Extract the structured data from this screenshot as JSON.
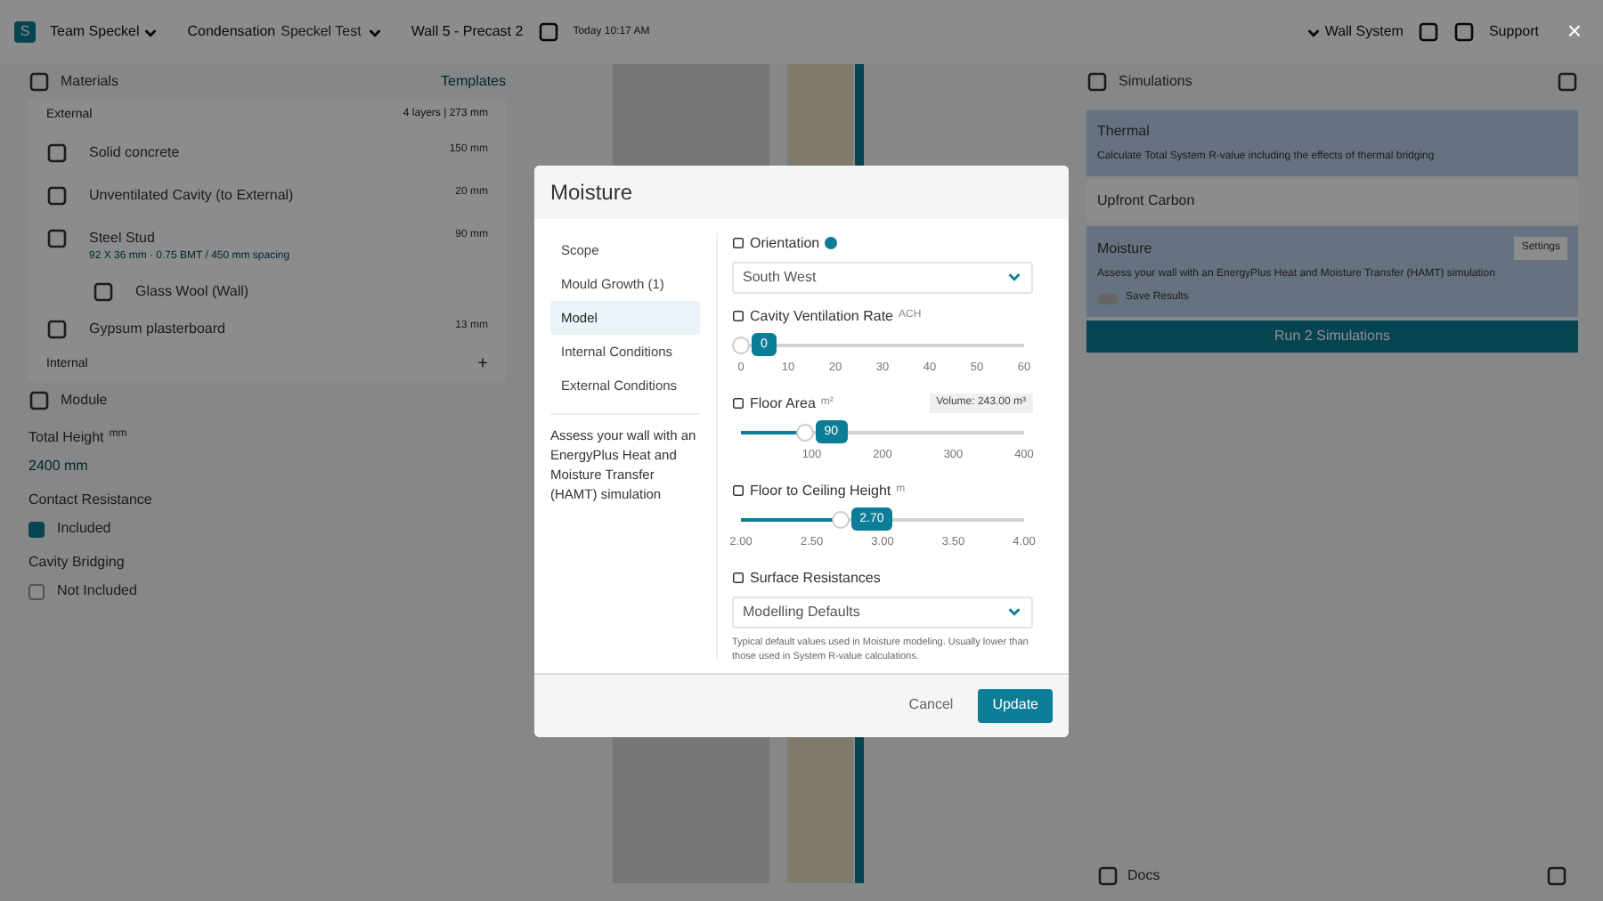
{
  "topbar": {
    "logo": "S",
    "team": "Team Speckel",
    "project_label": "Condensation",
    "project": "Speckel Test",
    "wall": "Wall 5 - Precast 2",
    "saved": "Today 10:17 AM",
    "system": "Wall System",
    "support": "Support"
  },
  "materials": {
    "title": "Materials",
    "templates": "Templates",
    "external": "External",
    "summary": "4 layers | 273 mm",
    "layers": [
      {
        "name": "Solid concrete",
        "thickness": "150 mm"
      },
      {
        "name": "Unventilated Cavity (to External)",
        "thickness": "20 mm"
      },
      {
        "name": "Steel Stud",
        "detail": "92 X 36 mm · 0.75 BMT / 450 mm spacing",
        "thickness": "90 mm",
        "children": [
          {
            "name": "Glass Wool (Wall)"
          }
        ]
      },
      {
        "name": "Gypsum plasterboard",
        "thickness": "13 mm"
      }
    ],
    "internal": "Internal",
    "add": "+"
  },
  "module": {
    "title": "Module",
    "total_height_label": "Total Height",
    "total_height_unit": "mm",
    "total_height": "2400 mm",
    "options": [
      {
        "label": "Contact Resistance",
        "value": "Included",
        "checked": true
      },
      {
        "label": "Cavity Bridging",
        "value": "Not Included",
        "checked": false
      }
    ]
  },
  "simulations": {
    "title": "Simulations",
    "items": [
      {
        "title": "Thermal",
        "description": "Calculate Total System R-value including the effects of thermal bridging",
        "selected": true
      },
      {
        "title": "Upfront Carbon",
        "selected": false
      },
      {
        "title": "Moisture",
        "settings": "Settings",
        "description": "Assess your wall with an EnergyPlus Heat and Moisture Transfer (HAMT) simulation",
        "toggle_label": "Save Results",
        "on": false,
        "selected": true
      }
    ],
    "run": "Run 2 Simulations",
    "docs": "Docs"
  },
  "modal": {
    "title": "Moisture",
    "nav": [
      {
        "label": "Scope",
        "selected": false
      },
      {
        "label": "Mould Growth (1)",
        "selected": false
      },
      {
        "label": "Model",
        "selected": true
      },
      {
        "label": "Internal Conditions",
        "selected": false
      },
      {
        "label": "External Conditions",
        "selected": false
      }
    ],
    "description": "Assess your wall with an EnergyPlus Heat and Moisture Transfer (HAMT) simulation",
    "fields": [
      {
        "kind": "select",
        "label": "Orientation",
        "help": true,
        "value": "South West"
      },
      {
        "kind": "slider",
        "label": "Cavity Ventilation Rate",
        "unit": "ACH",
        "level": 0,
        "reading": "0",
        "ticks": [
          "0",
          "10",
          "20",
          "30",
          "40",
          "50",
          "60"
        ]
      },
      {
        "kind": "offsetslider",
        "label": "Floor Area",
        "unit": "m²",
        "badge": "Volume: 243.00 m³",
        "level": 0.225,
        "reading": "90",
        "ticks": [
          "100",
          "200",
          "300",
          "400"
        ]
      },
      {
        "kind": "slider",
        "label": "Floor to Ceiling Height",
        "unit": "m",
        "level": 0.35,
        "reading": "2.70",
        "ticks": [
          "2.00",
          "2.50",
          "3.00",
          "3.50",
          "4.00"
        ]
      },
      {
        "kind": "select",
        "label": "Surface Resistances",
        "value": "Modelling Defaults",
        "note": "Typical default values used in Moisture modeling. Usually lower than those used in System R-value calculations."
      }
    ],
    "cancel": "Cancel",
    "update": "Update",
    "close": "×"
  }
}
